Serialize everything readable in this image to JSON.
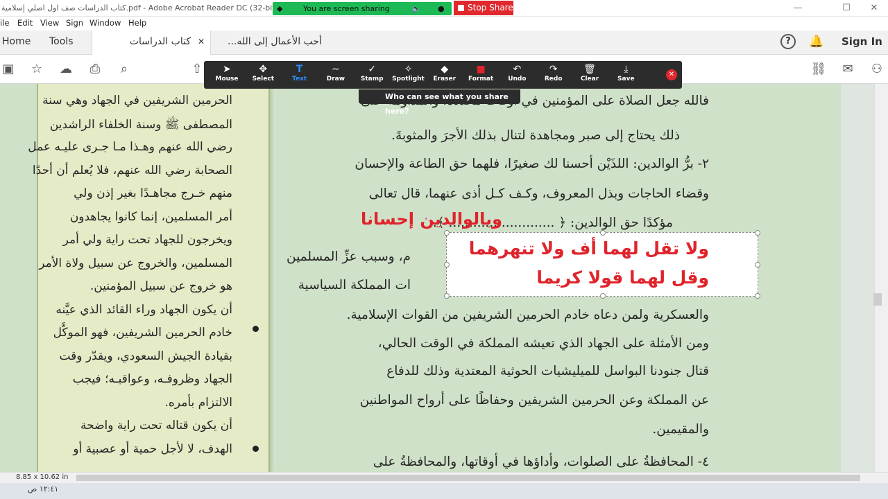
{
  "window": {
    "title": "كتاب الدراسات صف اول اصلي إسلامية.pdf - Adobe Acrobat Reader DC (32-bit)",
    "min": "—",
    "max": "☐",
    "close": "✕"
  },
  "share": {
    "status": "You are screen sharing",
    "stop": "Stop Share",
    "who": "Who can see what you share here?"
  },
  "menu": [
    "ile",
    "Edit",
    "View",
    "Sign",
    "Window",
    "Help"
  ],
  "tabs": {
    "home": "Home",
    "tools": "Tools",
    "doc1": "كتاب الدراسات صف...",
    "doc1_close": "✕",
    "doc2": "أحب الأعمال إلى الله...",
    "help": "?",
    "sign_in": "Sign In"
  },
  "annotate": [
    {
      "label": "Mouse",
      "glyph": "➤"
    },
    {
      "label": "Select",
      "glyph": "✥"
    },
    {
      "label": "Text",
      "glyph": "T"
    },
    {
      "label": "Draw",
      "glyph": "∼"
    },
    {
      "label": "Stamp",
      "glyph": "✓"
    },
    {
      "label": "Spotlight",
      "glyph": "✧"
    },
    {
      "label": "Eraser",
      "glyph": "◆"
    },
    {
      "label": "Format",
      "glyph": "■"
    },
    {
      "label": "Undo",
      "glyph": "↶"
    },
    {
      "label": "Redo",
      "glyph": "↷"
    },
    {
      "label": "Clear",
      "glyph": "🗑"
    },
    {
      "label": "Save",
      "glyph": "⤓"
    }
  ],
  "colors": {
    "accent_blue": "#2d8cff",
    "red": "#e0232b",
    "share_green": "#1db954",
    "stop_red": "#e0282d"
  },
  "left_column": [
    "الحرمين الشريفين في الجهاد وهي سنة",
    "المصطفى ﷺ وسنة الخلفاء الراشدين",
    "رضي الله عنهم وهـذا مـا جـرى عليـه عمل",
    "الصحابة رضي الله عنهم، فلا يُعلم أن أحدًا",
    "منهم خـرج مجاهـدًا بغير إذن ولي",
    "أمر المسلمين، إنما كانوا يجاهدون",
    "ويخرجون للجهاد تحت راية ولي أمر",
    "المسلمين، والخروج عن سبيل ولاة الأمر",
    "هو خروج عن سبيل المؤمنين.",
    "أن يكون الجهاد وراء القائد الذي عيَّنه",
    "خادم الحرمين الشريفين، فهو الموكَّل",
    "بقيادة الجيش السعودي، ويقدّر وقت",
    "الجهاد وظروفـه، وعواقبـه؛ فيجب",
    "الالتزام بأمره.",
    "أن يكون قتاله تحت راية واضحة",
    "الهدف، لا لأجل حمية أو عصبية أو"
  ],
  "main_lines": [
    "فالله جعل الصلاة على المؤمنين في أوقات محددة، والمداومة على",
    "ذلك يحتاج إلى صبر ومجاهدة لتنال بذلك الأجرَ والمثوبةَ.",
    "٢- برُّ الوالدين: اللذَيْن أحسنا لك صغيرًا، فلهما حق الطاعة والإحسان",
    "وقضاء الحاجات وبذل المعروف، وكـف كـل أذى عنهما، قال تعالى",
    "مؤكدًا حق الوالدين: ﴿ .......................... ﴾.",
    "م، وسبب عزِّ المسلمين",
    "ات المملكة السياسية",
    "والعسكرية ولمن دعاه خادم الحرمين الشريفين من القوات الإسلامية.",
    "ومن الأمثلة على الجهاد الذي تعيشه المملكة في الوقت الحالي،",
    "قتال جنودنا البواسل للميليشيات الحوثية المعتدية وذلك للدفاع",
    "عن المملكة وعن الحرمين الشريفين وحفاظًا على أرواح المواطنين",
    "والمقيمين.",
    "٤- المحافظةُ على الصلوات، وأداؤها في أوقاتها، والمحافظةُ على"
  ],
  "red_title": "وبالوالدين إحسانا",
  "textbox_lines": [
    "ولا تقل لهما أف ولا تنهرهما",
    "وقل لهما قولا كريما"
  ],
  "status": {
    "page_size": "8.85 x 10.62 in",
    "clock": "١٢:٤١ ص"
  }
}
